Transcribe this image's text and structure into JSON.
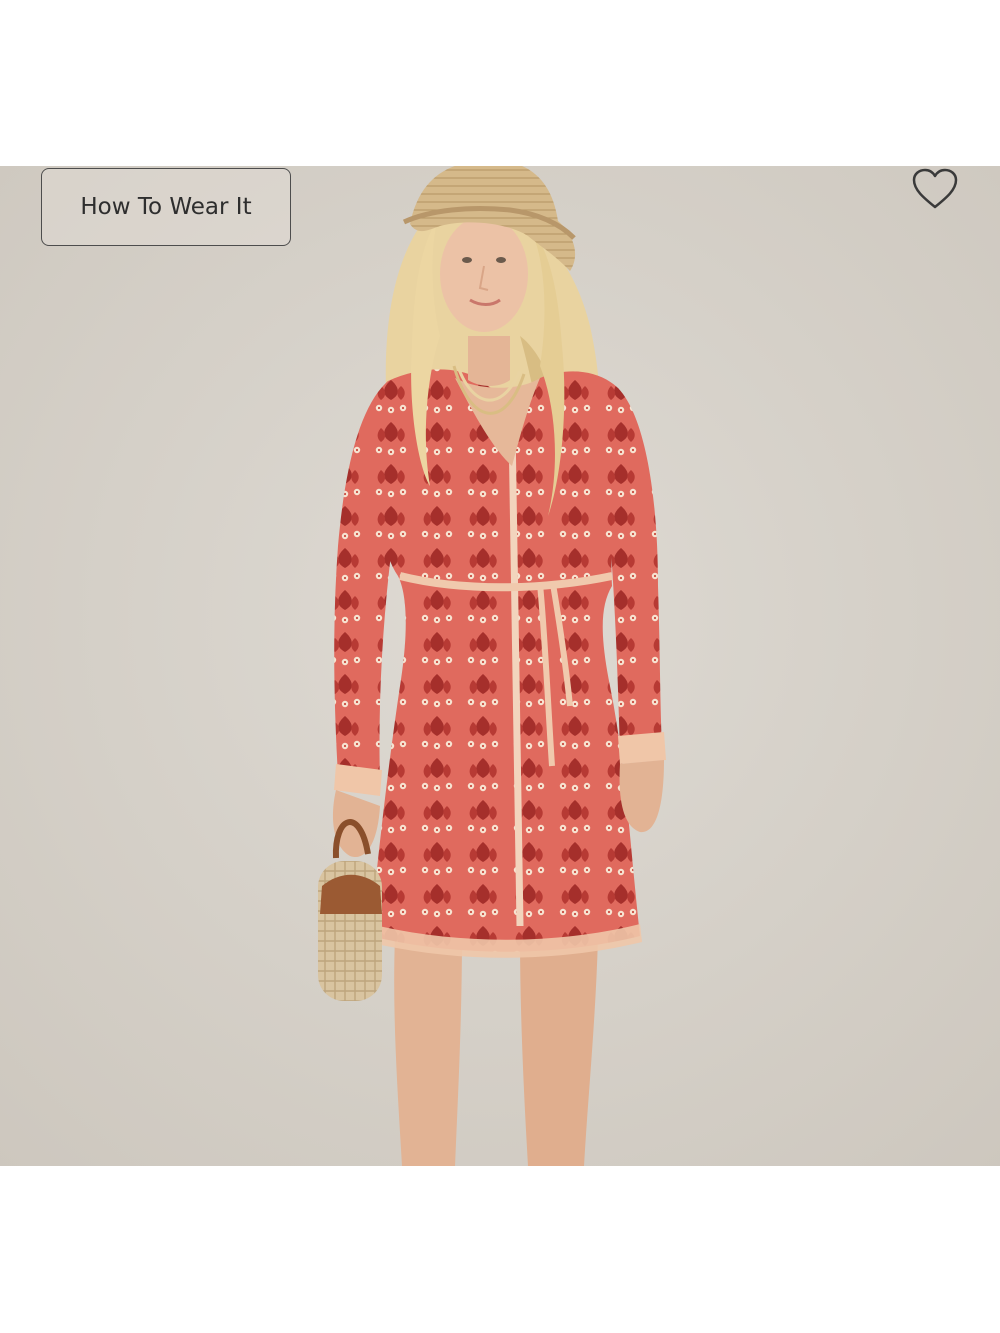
{
  "product": {
    "how_to_wear_label": "How To Wear It",
    "favorite_icon": "heart-outline-icon"
  },
  "colors": {
    "backdrop": "#d9d4cd",
    "dress_primary": "#e1675b",
    "dress_pattern": "#a8302d",
    "button_border": "#4d4d4d",
    "icon_stroke": "#3a3a3a"
  }
}
